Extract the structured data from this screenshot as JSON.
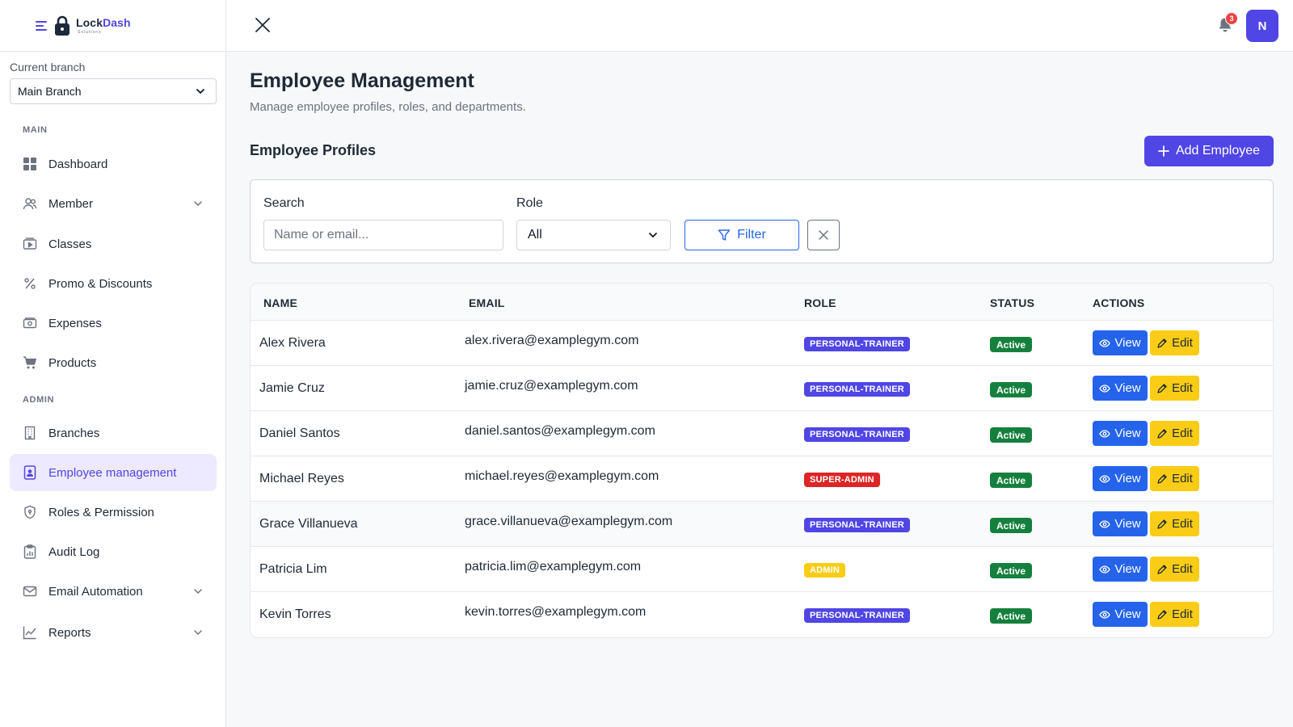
{
  "app": {
    "name_prefix": "Lock",
    "name_suffix": "Dash",
    "tagline": "Solutions"
  },
  "branch": {
    "label": "Current branch",
    "selected": "Main Branch"
  },
  "sidebar": {
    "main_label": "MAIN",
    "admin_label": "ADMIN",
    "items": [
      {
        "label": "Dashboard",
        "icon": "grid-icon"
      },
      {
        "label": "Member",
        "icon": "users-icon"
      },
      {
        "label": "Classes",
        "icon": "video-icon"
      },
      {
        "label": "Promo & Discounts",
        "icon": "percent-icon"
      },
      {
        "label": "Expenses",
        "icon": "cash-icon"
      },
      {
        "label": "Products",
        "icon": "cart-icon"
      },
      {
        "label": "Branches",
        "icon": "building-icon"
      },
      {
        "label": "Employee management",
        "icon": "id-badge-icon"
      },
      {
        "label": "Roles & Permission",
        "icon": "shield-icon"
      },
      {
        "label": "Audit Log",
        "icon": "clipboard-chart-icon"
      },
      {
        "label": "Email Automation",
        "icon": "envelope-icon"
      },
      {
        "label": "Reports",
        "icon": "line-chart-icon"
      }
    ]
  },
  "topbar": {
    "notification_count": "3",
    "avatar_initial": "N"
  },
  "page": {
    "title": "Employee Management",
    "subtitle": "Manage employee profiles, roles, and departments.",
    "section_title": "Employee Profiles",
    "add_button": "Add Employee"
  },
  "filters": {
    "search_label": "Search",
    "search_placeholder": "Name or email...",
    "role_label": "Role",
    "role_selected": "All",
    "filter_button": "Filter"
  },
  "table": {
    "columns": [
      "NAME",
      "EMAIL",
      "ROLE",
      "STATUS",
      "ACTIONS"
    ],
    "view_label": "View",
    "edit_label": "Edit",
    "rows": [
      {
        "name": "Alex Rivera",
        "email": "alex.rivera@examplegym.com",
        "role": "PERSONAL-TRAINER",
        "role_color": "#4f46e5",
        "status": "Active"
      },
      {
        "name": "Jamie Cruz",
        "email": "jamie.cruz@examplegym.com",
        "role": "PERSONAL-TRAINER",
        "role_color": "#4f46e5",
        "status": "Active"
      },
      {
        "name": "Daniel Santos",
        "email": "daniel.santos@examplegym.com",
        "role": "PERSONAL-TRAINER",
        "role_color": "#4f46e5",
        "status": "Active"
      },
      {
        "name": "Michael Reyes",
        "email": "michael.reyes@examplegym.com",
        "role": "SUPER-ADMIN",
        "role_color": "#dc2626",
        "status": "Active"
      },
      {
        "name": "Grace Villanueva",
        "email": "grace.villanueva@examplegym.com",
        "role": "PERSONAL-TRAINER",
        "role_color": "#4f46e5",
        "status": "Active"
      },
      {
        "name": "Patricia Lim",
        "email": "patricia.lim@examplegym.com",
        "role": "ADMIN",
        "role_color": "#facc15",
        "status": "Active"
      },
      {
        "name": "Kevin Torres",
        "email": "kevin.torres@examplegym.com",
        "role": "PERSONAL-TRAINER",
        "role_color": "#4f46e5",
        "status": "Active"
      }
    ]
  },
  "colors": {
    "brand": "#4f46e5",
    "primary": "#2563eb",
    "warning": "#facc15",
    "success": "#15803d",
    "danger": "#dc2626"
  }
}
